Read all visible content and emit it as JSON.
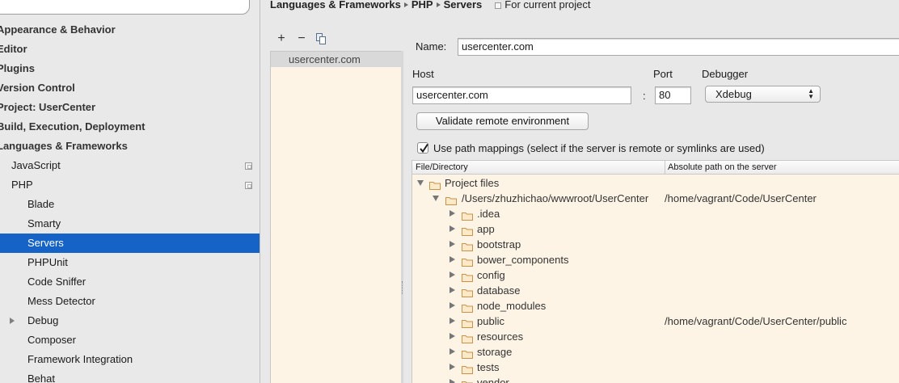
{
  "header": {
    "breadcrumb": [
      "Languages & Frameworks",
      "PHP",
      "Servers"
    ],
    "scope": "For current project"
  },
  "settings_tree": [
    {
      "label": "Appearance & Behavior",
      "level": 0
    },
    {
      "label": "Editor",
      "level": 0
    },
    {
      "label": "Plugins",
      "level": 0
    },
    {
      "label": "Version Control",
      "level": 0
    },
    {
      "label": "Project: UserCenter",
      "level": 0
    },
    {
      "label": "Build, Execution, Deployment",
      "level": 0
    },
    {
      "label": "Languages & Frameworks",
      "level": 0
    },
    {
      "label": "JavaScript",
      "level": 1
    },
    {
      "label": "PHP",
      "level": 1
    },
    {
      "label": "Blade",
      "level": 2
    },
    {
      "label": "Smarty",
      "level": 2
    },
    {
      "label": "Servers",
      "level": 2,
      "selected": true
    },
    {
      "label": "PHPUnit",
      "level": 2
    },
    {
      "label": "Code Sniffer",
      "level": 2
    },
    {
      "label": "Mess Detector",
      "level": 2
    },
    {
      "label": "Debug",
      "level": 2,
      "expandable": true
    },
    {
      "label": "Composer",
      "level": 2
    },
    {
      "label": "Framework Integration",
      "level": 2
    },
    {
      "label": "Behat",
      "level": 2
    }
  ],
  "servers_toolbar": {
    "add": "+",
    "remove": "−",
    "copy_icon": "copy-icon"
  },
  "servers": [
    "usercenter.com"
  ],
  "form": {
    "name_label": "Name:",
    "name_value": "usercenter.com",
    "host_label": "Host",
    "host_value": "usercenter.com",
    "port_label": "Port",
    "port_sep": ":",
    "port_value": "80",
    "debugger_label": "Debugger",
    "debugger_value": "Xdebug",
    "validate_button": "Validate remote environment",
    "use_path_mappings_label": "Use path mappings (select if the server is remote or symlinks are used)",
    "use_path_mappings_checked": true
  },
  "mappings": {
    "columns": [
      "File/Directory",
      "Absolute path on the server"
    ],
    "rows": [
      {
        "name": "Project files",
        "depth": 0,
        "expanded": true,
        "server_path": ""
      },
      {
        "name": "/Users/zhuzhichao/wwwroot/UserCenter",
        "depth": 1,
        "expanded": true,
        "server_path": "/home/vagrant/Code/UserCenter"
      },
      {
        "name": ".idea",
        "depth": 2,
        "expanded": false,
        "server_path": ""
      },
      {
        "name": "app",
        "depth": 2,
        "expanded": false,
        "server_path": ""
      },
      {
        "name": "bootstrap",
        "depth": 2,
        "expanded": false,
        "server_path": ""
      },
      {
        "name": "bower_components",
        "depth": 2,
        "expanded": false,
        "server_path": ""
      },
      {
        "name": "config",
        "depth": 2,
        "expanded": false,
        "server_path": ""
      },
      {
        "name": "database",
        "depth": 2,
        "expanded": false,
        "server_path": ""
      },
      {
        "name": "node_modules",
        "depth": 2,
        "expanded": false,
        "server_path": ""
      },
      {
        "name": "public",
        "depth": 2,
        "expanded": false,
        "server_path": "/home/vagrant/Code/UserCenter/public"
      },
      {
        "name": "resources",
        "depth": 2,
        "expanded": false,
        "server_path": ""
      },
      {
        "name": "storage",
        "depth": 2,
        "expanded": false,
        "server_path": ""
      },
      {
        "name": "tests",
        "depth": 2,
        "expanded": false,
        "server_path": ""
      },
      {
        "name": "vendor",
        "depth": 2,
        "expanded": false,
        "server_path": ""
      }
    ]
  },
  "colors": {
    "selection": "#1663c7",
    "list_background": "#fdf4e6",
    "sidebar_background": "#e9e9e9"
  }
}
